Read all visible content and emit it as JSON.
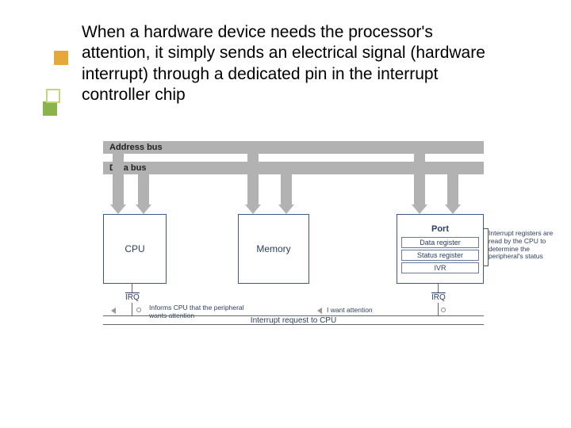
{
  "title": "When a hardware device needs the processor's attention, it simply sends an electrical signal (hardware interrupt) through a dedicated pin in the interrupt controller chip",
  "buses": {
    "address": "Address  bus",
    "data": "Data  bus",
    "irq": "Interrupt  request  to  CPU"
  },
  "blocks": {
    "cpu": "CPU",
    "memory": "Memory",
    "port": {
      "title": "Port",
      "registers": [
        "Data register",
        "Status register",
        "IVR"
      ]
    }
  },
  "irq_label": "IRQ",
  "notes": {
    "inform": "Informs CPU that the peripheral wants attention",
    "want": "I want attention",
    "side": "Interrupt registers are read by the CPU to determine the peripheral's status"
  }
}
